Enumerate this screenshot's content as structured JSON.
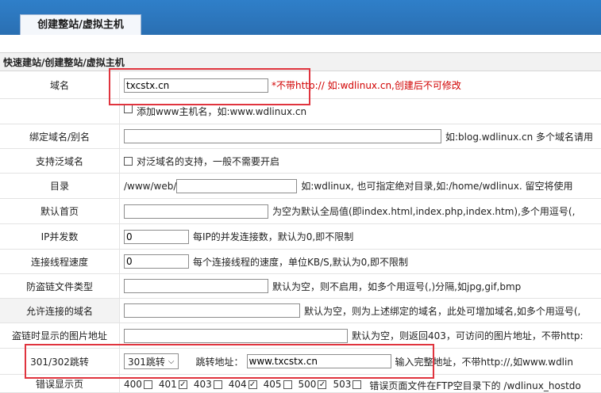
{
  "tab": "创建整站/虚拟主机",
  "section_title": "快速建站/创建整站/虚拟主机",
  "rows": {
    "domain": {
      "label": "域名",
      "value": "txcstx.cn",
      "note_star": "*不带http:// 如:wdlinux.cn,",
      "note_red": "创建后不可修改"
    },
    "add_www": {
      "label": "添加www主机名，如:www.wdlinux.cn"
    },
    "alias": {
      "label": "绑定域名/别名",
      "value": "",
      "hint": "如:blog.wdlinux.cn 多个域名请用"
    },
    "wildcard": {
      "label": "支持泛域名",
      "checkbox_label": "对泛域名的支持，一般不需要开启"
    },
    "dir": {
      "label": "目录",
      "prefix": "/www/web/",
      "value": "",
      "hint": "如:wdlinux, 也可指定绝对目录,如:/home/wdlinux. 留空将使用"
    },
    "index": {
      "label": "默认首页",
      "value": "",
      "hint": "为空为默认全局值(即index.html,index.php,index.htm),多个用逗号(,"
    },
    "ip_conn": {
      "label": "IP并发数",
      "value": "0",
      "hint": "每IP的并发连接数，默认为0,即不限制"
    },
    "speed": {
      "label": "连接线程速度",
      "value": "0",
      "hint": "每个连接线程的速度，单位KB/S,默认为0,即不限制"
    },
    "hotlink": {
      "label": "防盗链文件类型",
      "value": "",
      "hint": "默认为空，则不启用，如多个用逗号(,)分隔,如jpg,gif,bmp"
    },
    "allowed": {
      "label": "允许连接的域名",
      "value": "",
      "hint": "默认为空，则为上述绑定的域名，此处可增加域名,如多个用逗号(,"
    },
    "hotlink_img": {
      "label": "盗链时显示的图片地址",
      "value": "",
      "hint": "默认为空，则返回403，可访问的图片地址，不带http:"
    },
    "redirect": {
      "label": "301/302跳转",
      "select": "301跳转",
      "target_label": "跳转地址：",
      "value": "www.txcstx.cn",
      "hint": "输入完整地址，不带http://,如www.wdlin"
    },
    "partial": {
      "label": "错误显示页",
      "codes": [
        "400",
        "401",
        "403",
        "404",
        "405",
        "500",
        "503"
      ],
      "hint": "错误页面文件在FTP空目录下的 /wdlinux_hostdo"
    }
  }
}
